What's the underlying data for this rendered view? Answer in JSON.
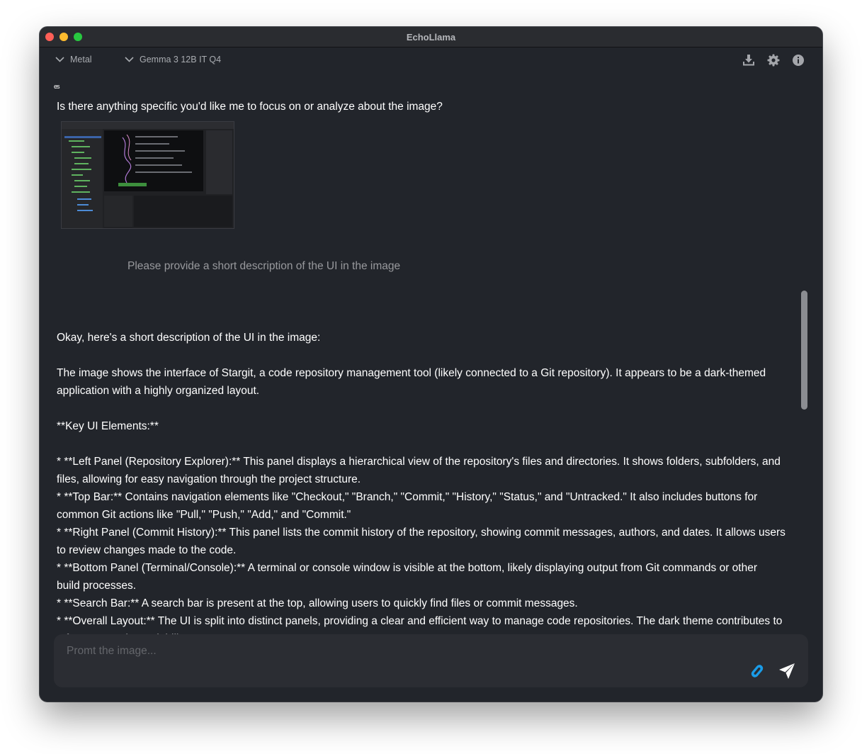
{
  "window": {
    "title": "EchoLlama"
  },
  "toolbar": {
    "backend_select": "Metal",
    "model_select": "Gemma 3 12B IT Q4",
    "icons": [
      "download-icon",
      "gear-icon",
      "info-icon"
    ]
  },
  "chat": {
    "clipped_fragment": "es",
    "previous_response_tail": "Is there anything specific you'd like me to focus on or analyze about the image?",
    "user_message": "Please provide a short description of the UI in the image",
    "response_lines": [
      "Okay, here's a short description of the UI in the image:",
      "",
      "The image shows the interface of Stargit, a code repository management tool (likely connected to a Git repository). It appears to be a dark-themed",
      "application with a highly organized layout.",
      "",
      "**Key UI Elements:**",
      "",
      "*   **Left Panel (Repository Explorer):** This panel displays a hierarchical view of the repository's files and directories. It shows folders, subfolders, and",
      "files, allowing for easy navigation through the project structure.",
      "*   **Top Bar:** Contains navigation elements like \"Checkout,\" \"Branch,\" \"Commit,\" \"History,\" \"Status,\" and \"Untracked.\" It also includes buttons for",
      "common Git actions like \"Pull,\" \"Push,\" \"Add,\" and \"Commit.\"",
      "*   **Right Panel (Commit History):** This panel lists the commit history of the repository, showing commit messages, authors, and dates. It allows users",
      "to review changes made to the code.",
      "*   **Bottom Panel (Terminal/Console):** A terminal or console window is visible at the bottom, likely displaying output from Git commands or other",
      "build processes.",
      "*   **Search Bar:** A search bar is present at the top, allowing users to quickly find files or commit messages.",
      "*   **Overall Layout:** The UI is split into distinct panels, providing a clear and efficient way to manage code repositories. The dark theme contributes to",
      "a focus on code readability."
    ]
  },
  "input": {
    "placeholder": "Promt the image..."
  },
  "colors": {
    "window_bg": "#22252b",
    "titlebar_bg": "#2a2c30",
    "input_bg": "#2b2d33",
    "accent_attach": "#1a9ce8",
    "text": "#ffffff",
    "muted_text": "#98999d"
  }
}
